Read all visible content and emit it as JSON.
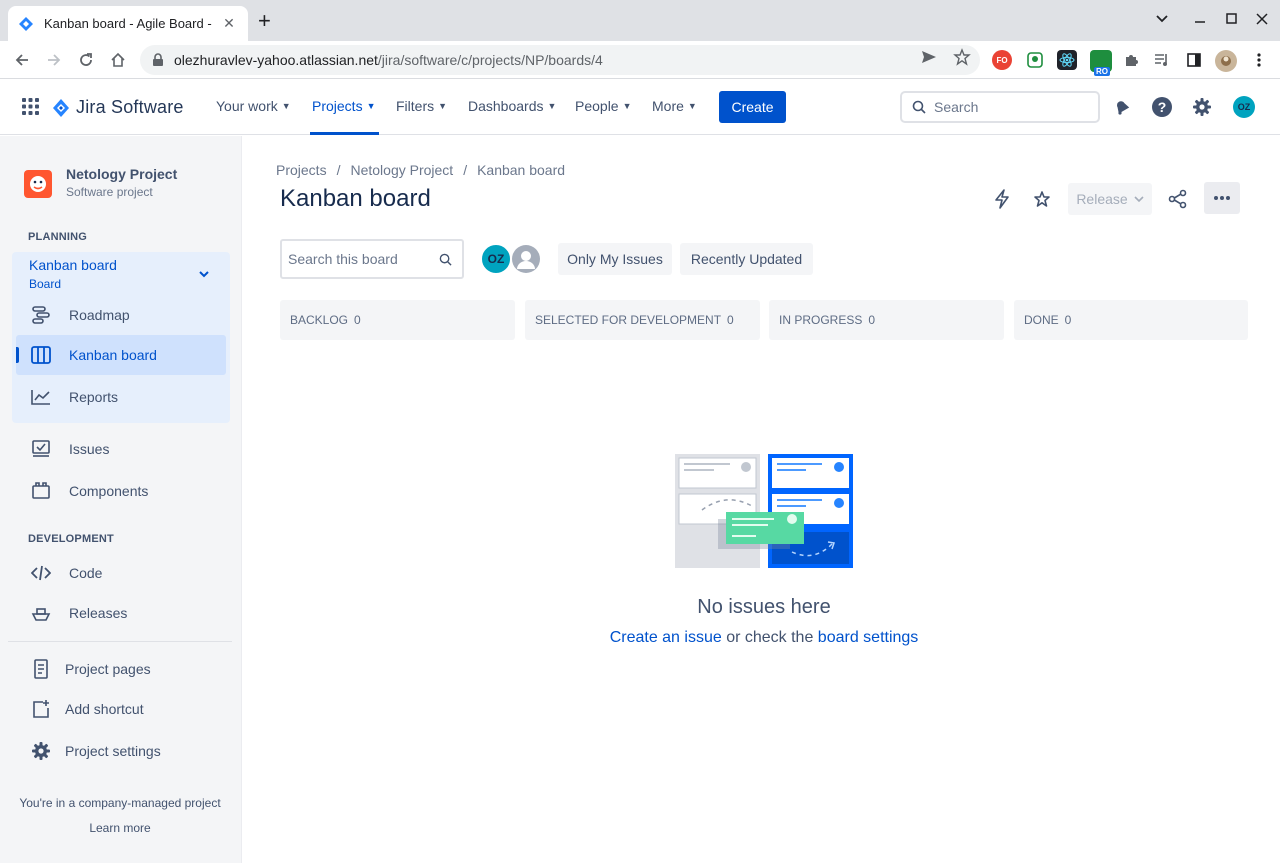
{
  "browser": {
    "tab_title": "Kanban board - Agile Board - J",
    "url_host": "olezhuravlev-yahoo.atlassian.net",
    "url_path": "/jira/software/c/projects/NP/boards/4",
    "ext_fo": "FO",
    "ext_ro": "RO"
  },
  "topnav": {
    "product": "Jira Software",
    "items": [
      "Your work",
      "Projects",
      "Filters",
      "Dashboards",
      "People",
      "More"
    ],
    "create": "Create",
    "search_placeholder": "Search",
    "avatar": "OZ"
  },
  "sidebar": {
    "project_name": "Netology Project",
    "project_type": "Software project",
    "planning": "PLANNING",
    "board_title": "Kanban board",
    "board_sub": "Board",
    "planning_items": [
      "Roadmap",
      "Kanban board",
      "Reports"
    ],
    "other_items": [
      "Issues",
      "Components"
    ],
    "development": "DEVELOPMENT",
    "dev_items": [
      "Code",
      "Releases"
    ],
    "bottom_items": [
      "Project pages",
      "Add shortcut",
      "Project settings"
    ],
    "footer_text": "You're in a company-managed project",
    "learn_more": "Learn more"
  },
  "main": {
    "breadcrumbs": [
      "Projects",
      "Netology Project",
      "Kanban board"
    ],
    "title": "Kanban board",
    "release": "Release",
    "board_search_placeholder": "Search this board",
    "avatar": "OZ",
    "filters": [
      "Only My Issues",
      "Recently Updated"
    ],
    "columns": [
      {
        "name": "BACKLOG",
        "count": "0"
      },
      {
        "name": "SELECTED FOR DEVELOPMENT",
        "count": "0"
      },
      {
        "name": "IN PROGRESS",
        "count": "0"
      },
      {
        "name": "DONE",
        "count": "0"
      }
    ],
    "empty_title": "No issues here",
    "empty_link1": "Create an issue",
    "empty_middle": " or check the ",
    "empty_link2": "board settings"
  },
  "colors": {
    "brand": "#0052cc",
    "avatar": "#00a3bf"
  }
}
